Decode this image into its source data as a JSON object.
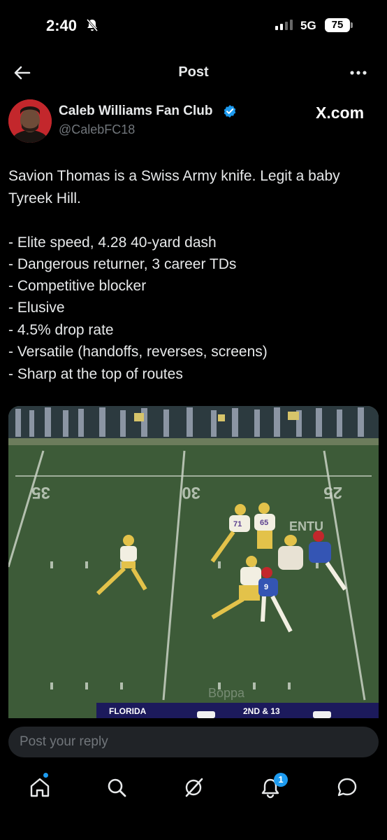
{
  "status_bar": {
    "time": "2:40",
    "network": "5G",
    "battery": "75"
  },
  "header": {
    "title": "Post"
  },
  "tweet": {
    "display_name": "Caleb Williams Fan Club",
    "handle": "@CalebFC18",
    "source": "X.com",
    "lines": [
      "Savion Thomas is a Swiss Army knife. Legit a baby",
      "Tyreek Hill.",
      "- Elite speed, 4.28 40-yard dash",
      "- Dangerous returner, 3 career TDs",
      "- Competitive blocker",
      "- Elusive",
      "- 4.5% drop rate",
      "- Versatile (handoffs, reverses, screens)",
      "- Sharp at the top of routes"
    ]
  },
  "media": {
    "scoreboard_team": "FLORIDA",
    "scoreboard_down": "2ND & 13",
    "yard_numbers": [
      "35",
      "30",
      "25"
    ],
    "field_wall_text": "ENTU",
    "watermark": "Boppa",
    "jersey_numbers": [
      "71",
      "65",
      "9"
    ]
  },
  "reply": {
    "placeholder": "Post your reply"
  },
  "tab_bar": {
    "notification_count": "1"
  },
  "colors": {
    "accent": "#1d9bf0",
    "background": "#000000",
    "secondary_text": "#71767b"
  },
  "icons": [
    "back-arrow-icon",
    "more-icon",
    "verified-icon",
    "home-icon",
    "search-icon",
    "grok-icon",
    "bell-icon",
    "messages-icon"
  ]
}
